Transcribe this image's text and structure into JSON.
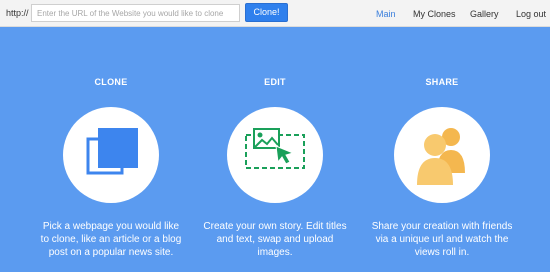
{
  "topbar": {
    "prefix": "http://",
    "url_placeholder": "Enter the URL of the Website you would like to clone",
    "clone_button": "Clone!",
    "nav": [
      {
        "label": "Main",
        "active": true
      },
      {
        "label": "My Clones",
        "active": false
      },
      {
        "label": "Gallery",
        "active": false
      },
      {
        "label": "Log out",
        "active": false
      }
    ]
  },
  "features": [
    {
      "title": "CLONE",
      "icon": "clone-icon",
      "desc": "Pick a webpage you would like to clone, like an article or a blog post on a popular news site."
    },
    {
      "title": "EDIT",
      "icon": "edit-image-icon",
      "desc": "Create your own story. Edit titles and text, swap and upload images."
    },
    {
      "title": "SHARE",
      "icon": "users-icon",
      "desc": "Share your creation with friends via a unique url and watch the views roll in."
    }
  ],
  "colors": {
    "background": "#5b9bf0",
    "accent_blue": "#2f80ed",
    "edit_green": "#1aa05a",
    "share_orange": "#f7c76a"
  }
}
